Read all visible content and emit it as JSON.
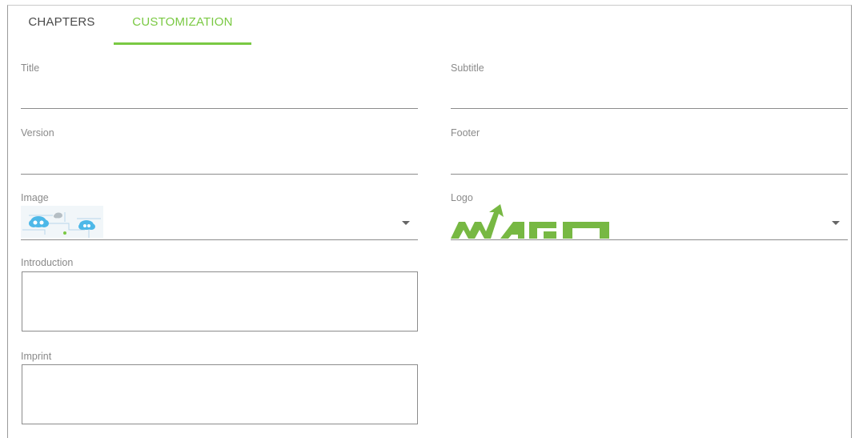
{
  "tabs": {
    "chapters": "CHAPTERS",
    "customization": "CUSTOMIZATION",
    "active": "customization",
    "accent_color": "#7ac943"
  },
  "form": {
    "title": {
      "label": "Title",
      "value": ""
    },
    "subtitle": {
      "label": "Subtitle",
      "value": ""
    },
    "version": {
      "label": "Version",
      "value": ""
    },
    "footer": {
      "label": "Footer",
      "value": ""
    },
    "image": {
      "label": "Image",
      "selected": "cloud-network-thumbnail"
    },
    "logo": {
      "label": "Logo",
      "selected": "wago-logo"
    },
    "introduction": {
      "label": "Introduction",
      "value": ""
    },
    "imprint": {
      "label": "Imprint",
      "value": ""
    }
  },
  "icons": {
    "dropdown": "chevron-down-icon",
    "image_thumb": "cloud-network-image",
    "logo_brand": "wago-logo"
  },
  "colors": {
    "accent": "#7ac943",
    "logo_green": "#77b843",
    "cloud_blue": "#4db8e8"
  }
}
